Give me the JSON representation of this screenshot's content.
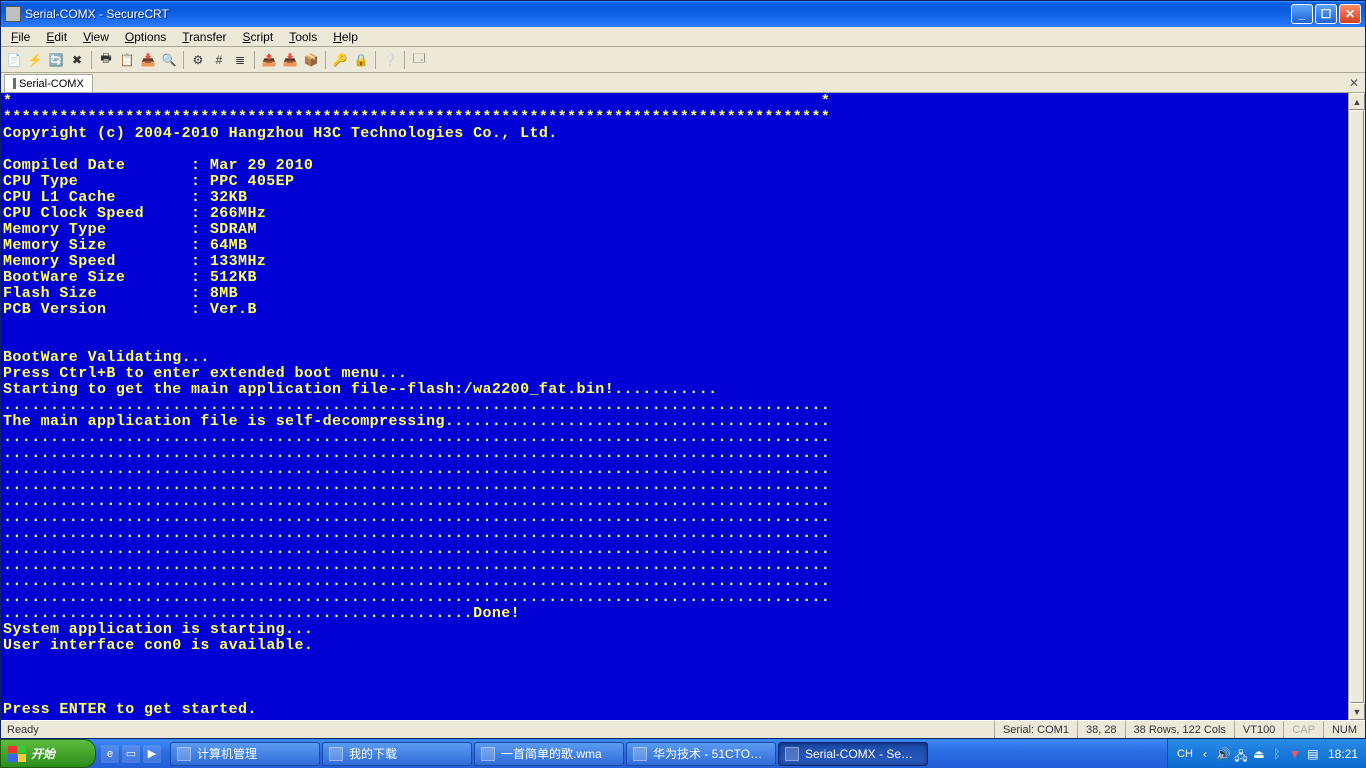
{
  "window": {
    "title": "Serial-COMX - SecureCRT",
    "menus": [
      "File",
      "Edit",
      "View",
      "Options",
      "Transfer",
      "Script",
      "Tools",
      "Help"
    ],
    "tab_label": "Serial-COMX"
  },
  "toolbar_icons": [
    "new-session",
    "quick-connect",
    "reconnect",
    "disconnect",
    "|",
    "print",
    "copy",
    "paste",
    "find",
    "|",
    "properties",
    "hex",
    "log",
    "|",
    "xmodem",
    "ymodem",
    "zmodem",
    "|",
    "key",
    "lock",
    "|",
    "help",
    "|",
    "options"
  ],
  "terminal_lines": [
    "*                                                                                      *",
    "****************************************************************************************",
    "Copyright (c) 2004-2010 Hangzhou H3C Technologies Co., Ltd.",
    "",
    "Compiled Date       : Mar 29 2010",
    "CPU Type            : PPC 405EP",
    "CPU L1 Cache        : 32KB",
    "CPU Clock Speed     : 266MHz",
    "Memory Type         : SDRAM",
    "Memory Size         : 64MB",
    "Memory Speed        : 133MHz",
    "BootWare Size       : 512KB",
    "Flash Size          : 8MB",
    "PCB Version         : Ver.B",
    "",
    "",
    "BootWare Validating...",
    "Press Ctrl+B to enter extended boot menu...",
    "Starting to get the main application file--flash:/wa2200_fat.bin!...........",
    "........................................................................................",
    "The main application file is self-decompressing.........................................",
    "........................................................................................",
    "........................................................................................",
    "........................................................................................",
    "........................................................................................",
    "........................................................................................",
    "........................................................................................",
    "........................................................................................",
    "........................................................................................",
    "........................................................................................",
    "........................................................................................",
    "........................................................................................",
    "..................................................Done!",
    "System application is starting...",
    "User interface con0 is available.",
    "",
    "",
    "",
    "Press ENTER to get started."
  ],
  "statusbar": {
    "ready": "Ready",
    "port": "Serial: COM1",
    "cursor": "38,  28",
    "size": "38 Rows, 122 Cols",
    "emu": "VT100",
    "caps": "CAP",
    "num": "NUM"
  },
  "taskbar": {
    "start": "开始",
    "tasks": [
      {
        "label": "计算机管理",
        "active": false
      },
      {
        "label": "我的下载",
        "active": false
      },
      {
        "label": "一首简单的歌.wma",
        "active": false
      },
      {
        "label": "华为技术 - 51CTO…",
        "active": false
      },
      {
        "label": "Serial-COMX - Se…",
        "active": true
      }
    ],
    "lang": "CH",
    "clock": "18:21"
  }
}
